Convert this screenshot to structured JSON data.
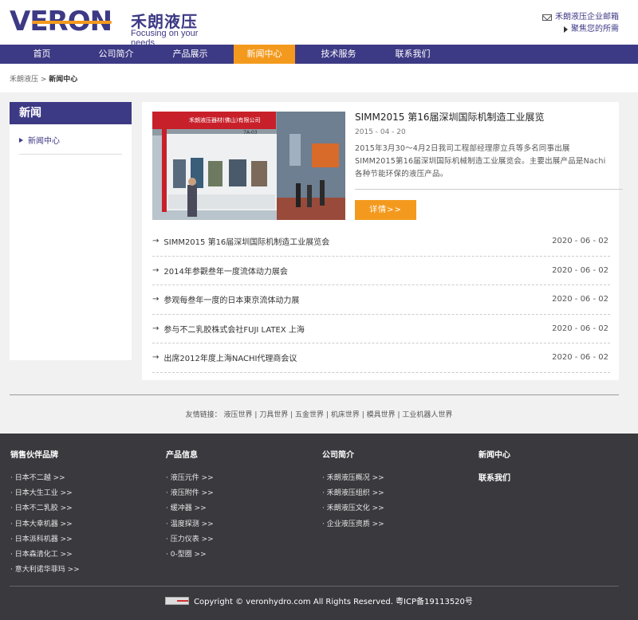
{
  "header": {
    "logo_text": "VERON",
    "logo_cn": "禾朗液压",
    "slogan": "Focusing on your needs",
    "mail_link": "禾朗液压企业邮箱",
    "focus_link": "聚焦您的所需"
  },
  "nav": {
    "items": [
      "首页",
      "公司简介",
      "产品展示",
      "新闻中心",
      "技术服务",
      "联系我们"
    ],
    "active_index": 3
  },
  "breadcrumb": {
    "home": "禾朗液压",
    "sep": " > ",
    "current": "新闻中心"
  },
  "sidebar": {
    "title": "新闻",
    "items": [
      "新闻中心"
    ]
  },
  "feature": {
    "title": "SIMM2015 第16届深圳国际机制造工业展览",
    "date": "2015 - 04 - 20",
    "desc": "2015年3月30～4月2日我司工程部经理廖立兵等多名同事出展SIMM2015第16届深圳国际机械制造工业展览会。主要出展产品是Nachi各种节能环保的液压产品。",
    "more_label": "详情>>",
    "booth_sign": "禾朗液压器材(佛山)有限公司",
    "booth_no": "7A-03"
  },
  "news": [
    {
      "title": "SIMM2015 第16届深圳国际机制造工业展览会",
      "date": "2020 - 06 - 02"
    },
    {
      "title": "2014年参觀叁年一度流体动力展会",
      "date": "2020 - 06 - 02"
    },
    {
      "title": "参观每叁年一度的日本東京流体动力展",
      "date": "2020 - 06 - 02"
    },
    {
      "title": "参与不二乳胶株式会社FUJI LATEX 上海",
      "date": "2020 - 06 - 02"
    },
    {
      "title": "出席2012年度上海NACHI代理商会议",
      "date": "2020 - 06 - 02"
    }
  ],
  "news_arrow": "→",
  "friend_links": {
    "label": "友情链接：",
    "items": [
      "液压世界",
      "刀具世界",
      "五金世界",
      "机床世界",
      "模具世界",
      "工业机器人世界"
    ]
  },
  "footer": {
    "col1": {
      "title": "销售伙伴品牌",
      "items": [
        "· 日本不二越 >>",
        "· 日本大生工业 >>",
        "· 日本不二乳胶 >>",
        "· 日本大幸机器 >>",
        "· 日本派科机器 >>",
        "· 日本森清化工 >>",
        "· 意大利诺华菲玛 >>"
      ]
    },
    "col2": {
      "title": "产品信息",
      "items": [
        "· 液压元件 >>",
        "· 液压附件 >>",
        "· 缓冲器 >>",
        "· 温度探测 >>",
        "· 压力仪表 >>",
        "· 0-型圈 >>"
      ]
    },
    "col3": {
      "title": "公司简介",
      "items": [
        "· 禾朗液压概况 >>",
        "· 禾朗液压组织 >>",
        "· 禾朗液压文化 >>",
        "· 企业液压资质 >>"
      ]
    },
    "col4": {
      "title": "新闻中心",
      "title2": "联系我们"
    },
    "copyright": "Copyright © veronhydro.com All Rights Reserved. 粤ICP备19113520号"
  },
  "colors": {
    "brand": "#3d3a85",
    "accent": "#f39a1e",
    "footer_bg": "#3a393e"
  }
}
